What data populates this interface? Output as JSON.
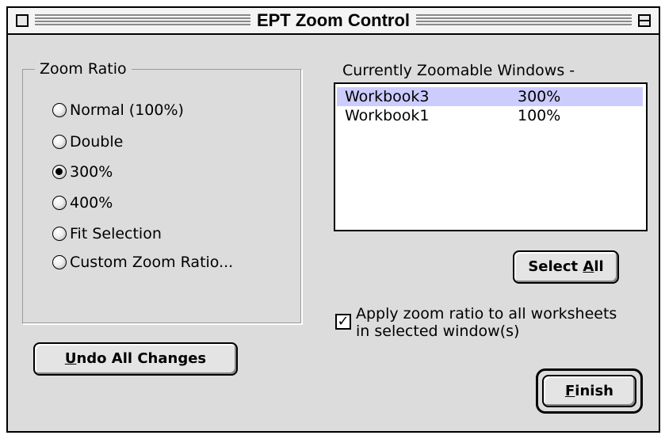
{
  "window": {
    "title": "EPT Zoom Control"
  },
  "zoom_ratio": {
    "label": "Zoom Ratio",
    "options": [
      {
        "label": "Normal (100%)",
        "selected": false
      },
      {
        "label": "Double",
        "selected": false
      },
      {
        "label": "300%",
        "selected": true
      },
      {
        "label": "400%",
        "selected": false
      },
      {
        "label": "Fit Selection",
        "selected": false
      },
      {
        "label": "Custom Zoom Ratio...",
        "selected": false
      }
    ]
  },
  "zoomable_windows": {
    "label": "Currently Zoomable Windows -",
    "rows": [
      {
        "name": "Workbook3",
        "zoom": "300%",
        "selected": true
      },
      {
        "name": "Workbook1",
        "zoom": "100%",
        "selected": false
      }
    ]
  },
  "buttons": {
    "select_all": {
      "pre": "Select ",
      "mnemonic": "A",
      "post": "ll"
    },
    "undo_all": {
      "pre": "",
      "mnemonic": "U",
      "post": "ndo All Changes"
    },
    "finish": {
      "pre": "",
      "mnemonic": "F",
      "post": "inish"
    }
  },
  "apply_checkbox": {
    "checked": true,
    "line1": "Apply zoom ratio to all worksheets",
    "line2": "in selected window(s)"
  },
  "icons": {
    "checkmark": "✓"
  },
  "colors": {
    "selection": "#ccccff",
    "window_bg": "#dcdcdc"
  }
}
